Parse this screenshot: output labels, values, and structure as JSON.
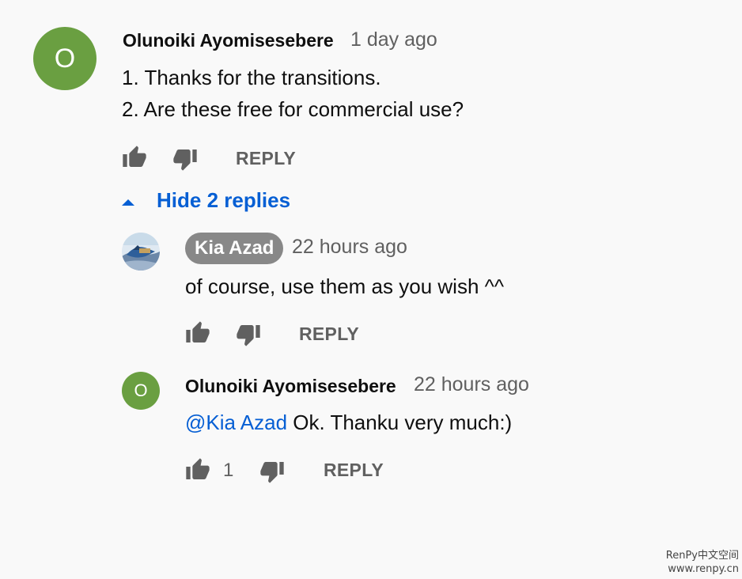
{
  "comment": {
    "avatar_letter": "O",
    "author": "Olunoiki Ayomisesebere",
    "time": "1 day ago",
    "lines": [
      "1. Thanks for the transitions.",
      "2. Are these free for commercial use?"
    ],
    "reply_label": "REPLY",
    "like_icon": "thumb-up-icon",
    "dislike_icon": "thumb-down-icon"
  },
  "replies_toggle": {
    "icon": "caret-up-icon",
    "label": "Hide 2 replies"
  },
  "replies": [
    {
      "author": "Kia Azad",
      "time": "22 hours ago",
      "text": "of course, use them as you wish ^^",
      "reply_label": "REPLY",
      "is_owner": true
    },
    {
      "avatar_letter": "O",
      "author": "Olunoiki Ayomisesebere",
      "time": "22 hours ago",
      "mention": "@Kia Azad",
      "text": " Ok. Thanku very much:)",
      "like_count": "1",
      "reply_label": "REPLY"
    }
  ],
  "watermark": {
    "line1": "RenPy中文空间",
    "line2": "www.renpy.cn"
  },
  "colors": {
    "background": "#f9f9f9",
    "avatar_green": "#6a9f41",
    "link_blue": "#065fd4",
    "secondary_text": "#606060",
    "owner_chip": "#888888"
  }
}
